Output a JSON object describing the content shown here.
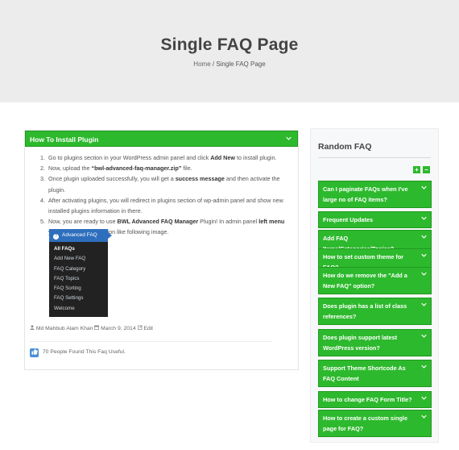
{
  "hero": {
    "title": "Single FAQ Page",
    "breadcrumb_home": "Home",
    "breadcrumb_sep": " / ",
    "breadcrumb_current": "Single FAQ Page"
  },
  "faq": {
    "title": "How To Install Plugin",
    "steps": [
      {
        "num": "1.",
        "parts": [
          "Go to plugins section in your WordPress admin panel and click ",
          "Add New",
          " to install plugin."
        ]
      },
      {
        "num": "2.",
        "parts": [
          "Now, upload the ",
          "“bwl-advanced-faq-manager.zip”",
          " file."
        ]
      },
      {
        "num": "3.",
        "parts": [
          "Once plugin uploaded successfully, you will get a ",
          "success message",
          " and then activate the plugin."
        ]
      },
      {
        "num": "4.",
        "parts": [
          "After activating plugins, you will redirect in plugins section of wp-admin panel and show new installed plugins information in there.",
          "",
          ""
        ]
      },
      {
        "num": "5.",
        "parts": [
          "Now, you are ready to use ",
          "BWL Advanced FAQ Manager",
          " Plugin! In admin panel ",
          "left menu",
          " you will see a new section like following image."
        ]
      }
    ],
    "admin_menu": {
      "header": "Advanced FAQ",
      "items": [
        "All FAQs",
        "Add New FAQ",
        "FAQ Category",
        "FAQ Topics",
        "FAQ Sorting",
        "FAQ Settings",
        "Welcome"
      ]
    },
    "author": "Md Mahbub Alam Khan",
    "date": "March 9, 2014",
    "edit": "Edit",
    "useful_text": "70 People Found This Faq Useful."
  },
  "sidebar": {
    "title": "Random FAQ",
    "plus": "+",
    "minus": "−",
    "questions": [
      "Can I paginate FAQs when I've large no of FAQ items?",
      "Frequent Updates",
      "Add FAQ Items/Categories/Topics?",
      "How to set custom theme for FAQ?",
      "How do we remove the \"Add a New FAQ\" option?",
      "Does plugin has a list of class references?",
      "Does plugin support latest WordPress version?",
      "Support Theme Shortcode As FAQ Content",
      "How to change FAQ Form Title?",
      "How to create a custom single page for FAQ?"
    ]
  },
  "icons": {
    "chevron": "chevron-down-icon",
    "user": "user-icon",
    "calendar": "calendar-icon",
    "edit": "edit-icon",
    "thumb": "thumbs-up-icon"
  },
  "colors": {
    "accent_green": "#2db92d",
    "admin_blue": "#2e6fbd",
    "hero_bg": "#ececec"
  }
}
